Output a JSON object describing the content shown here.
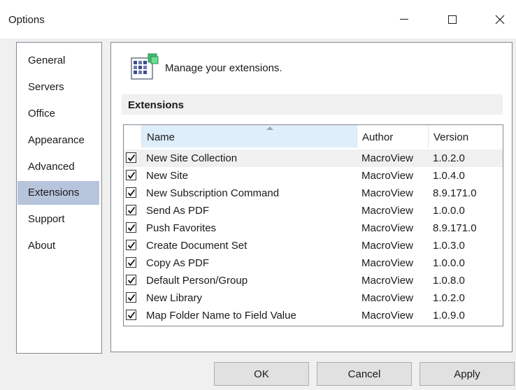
{
  "window": {
    "title": "Options"
  },
  "sidebar": {
    "items": [
      {
        "label": "General"
      },
      {
        "label": "Servers"
      },
      {
        "label": "Office"
      },
      {
        "label": "Appearance"
      },
      {
        "label": "Advanced"
      },
      {
        "label": "Extensions",
        "selected": true
      },
      {
        "label": "Support"
      },
      {
        "label": "About"
      }
    ]
  },
  "header": {
    "text": "Manage your extensions.",
    "icon": "extensions-grid-icon"
  },
  "section": {
    "title": "Extensions"
  },
  "grid": {
    "columns": {
      "name": "Name",
      "author": "Author",
      "version": "Version"
    },
    "sorted_column": "Name",
    "rows": [
      {
        "checked": true,
        "name": "New Site Collection",
        "author": "MacroView",
        "version": "1.0.2.0"
      },
      {
        "checked": true,
        "name": "New Site",
        "author": "MacroView",
        "version": "1.0.4.0"
      },
      {
        "checked": true,
        "name": "New Subscription Command",
        "author": "MacroView",
        "version": "8.9.171.0"
      },
      {
        "checked": true,
        "name": "Send As PDF",
        "author": "MacroView",
        "version": "1.0.0.0"
      },
      {
        "checked": true,
        "name": "Push Favorites",
        "author": "MacroView",
        "version": "8.9.171.0"
      },
      {
        "checked": true,
        "name": "Create Document Set",
        "author": "MacroView",
        "version": "1.0.3.0"
      },
      {
        "checked": true,
        "name": "Copy As PDF",
        "author": "MacroView",
        "version": "1.0.0.0"
      },
      {
        "checked": true,
        "name": "Default Person/Group",
        "author": "MacroView",
        "version": "1.0.8.0"
      },
      {
        "checked": true,
        "name": "New Library",
        "author": "MacroView",
        "version": "1.0.2.0"
      },
      {
        "checked": true,
        "name": "Map Folder Name to Field Value",
        "author": "MacroView",
        "version": "1.0.9.0"
      }
    ]
  },
  "buttons": {
    "ok": "OK",
    "cancel": "Cancel",
    "apply": "Apply"
  }
}
